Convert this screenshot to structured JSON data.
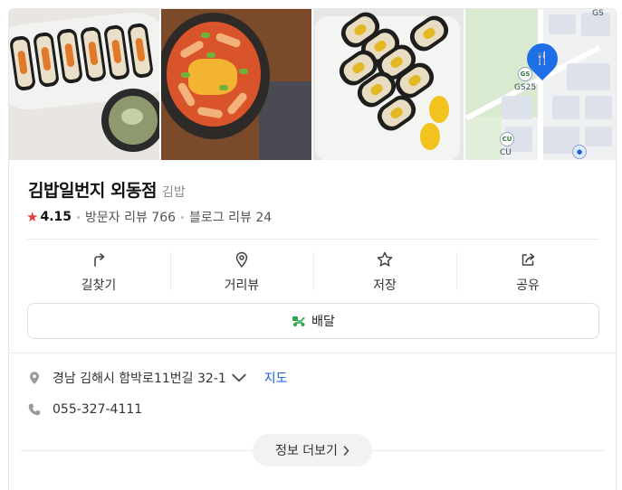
{
  "place": {
    "name": "김밥일번지 외동점",
    "category": "김밥",
    "rating": "4.15",
    "visitor_reviews": "방문자 리뷰 766",
    "blog_reviews": "블로그 리뷰 24"
  },
  "photos": [
    {
      "alt": "kimbap-plate-photo"
    },
    {
      "alt": "tteokbokki-photo"
    },
    {
      "alt": "kimbap-rolls-photo"
    },
    {
      "alt": "location-map"
    }
  ],
  "map_labels": {
    "poi1": "GS25",
    "poi2": "CU",
    "corner": "GS25",
    "gs_short": "GS"
  },
  "actions": [
    {
      "label": "길찾기",
      "icon": "directions-icon"
    },
    {
      "label": "거리뷰",
      "icon": "streetview-pin-icon"
    },
    {
      "label": "저장",
      "icon": "star-outline-icon"
    },
    {
      "label": "공유",
      "icon": "share-icon"
    }
  ],
  "delivery": {
    "label": "배달",
    "icon": "delivery-scooter-icon"
  },
  "address": {
    "text": "경남 김해시 함박로11번길 32-1",
    "map_link": "지도"
  },
  "phone": "055-327-4111",
  "more_info": "정보 더보기",
  "colors": {
    "star": "#e23b3b",
    "link": "#1a5fd6",
    "pin": "#1e6fe6",
    "delivery_icon": "#2aa84a"
  }
}
